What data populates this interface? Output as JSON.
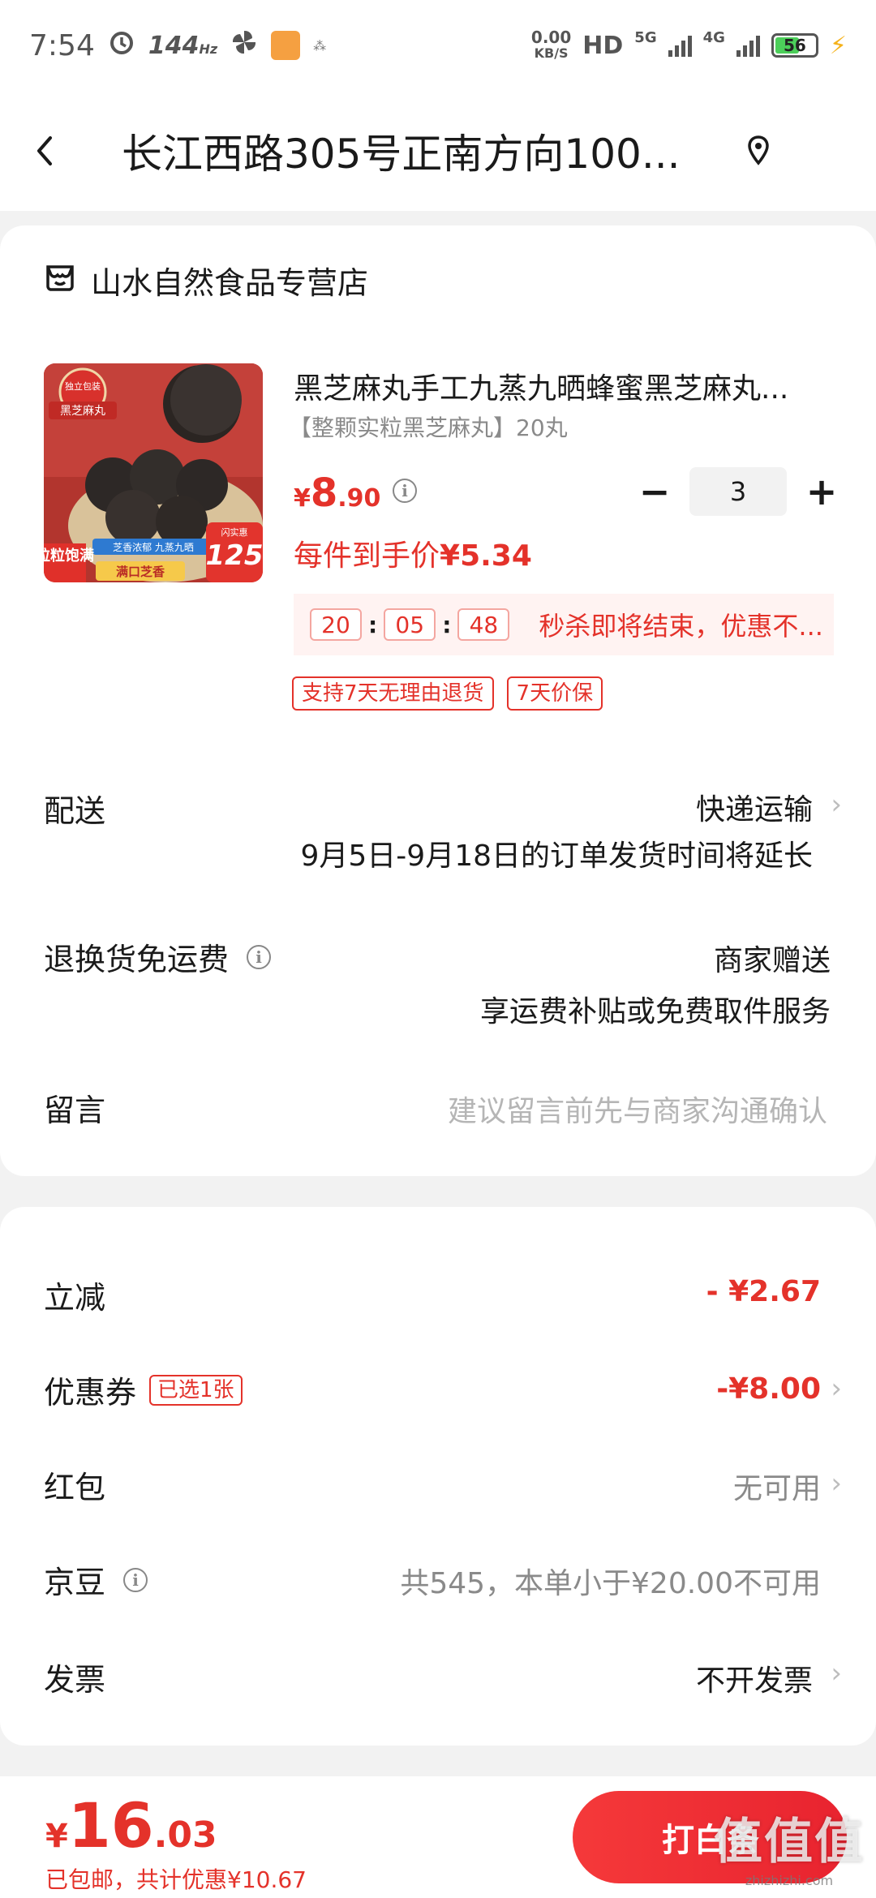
{
  "status_bar": {
    "time": "7:54",
    "refresh_rate": "144",
    "refresh_unit": "Hz",
    "net_speed": "0.00",
    "net_unit": "KB/S",
    "hd": "HD",
    "net_5g": "5G",
    "net_4g": "4G",
    "battery": "56"
  },
  "header": {
    "address": "长江西路305号正南方向100..."
  },
  "store": {
    "name": "山水自然食品专营店"
  },
  "product": {
    "image_text": {
      "badge": "独立包装",
      "name": "黑芝麻丸",
      "banner": "芝香浓郁 九蒸九晒",
      "side": "粒粒饱满",
      "count_label": "闪实惠",
      "count": "125",
      "bottom": "满口芝香"
    },
    "title": "黑芝麻丸手工九蒸九晒蜂蜜黑芝麻丸...",
    "spec": "【整颗实粒黑芝麻丸】20丸",
    "price_symbol": "¥",
    "price_int": "8",
    "price_dec": ".90",
    "quantity": "3",
    "final_price_label": "每件到手价",
    "final_price": "¥5.34",
    "timer": {
      "h": "20",
      "m": "05",
      "s": "48"
    },
    "flash_text": "秒杀即将结束，优惠不...",
    "tags": [
      "支持7天无理由退货",
      "7天价保"
    ]
  },
  "delivery": {
    "label": "配送",
    "method": "快递运输",
    "note": "9月5日-9月18日的订单发货时间将延长"
  },
  "return_shipping": {
    "label": "退换货免运费",
    "value": "商家赠送",
    "note": "享运费补贴或免费取件服务"
  },
  "message": {
    "label": "留言",
    "placeholder": "建议留言前先与商家沟通确认"
  },
  "discounts": {
    "instant": {
      "label": "立减",
      "value": "- ¥2.67"
    },
    "coupon": {
      "label": "优惠券",
      "badge": "已选1张",
      "value": "-¥8.00"
    },
    "red_packet": {
      "label": "红包",
      "value": "无可用"
    },
    "jd_beans": {
      "label": "京豆",
      "value": "共545，本单小于¥20.00不可用"
    },
    "invoice": {
      "label": "发票",
      "value": "不开发票"
    }
  },
  "bottom": {
    "total_symbol": "¥",
    "total_int": "16",
    "total_dec": ".03",
    "note": "已包邮，共计优惠¥10.67",
    "pay_label": "打白条",
    "watermark": "值值值",
    "watermark_sub": "zhizhizhi.com"
  },
  "colors": {
    "accent": "#e4322a",
    "background": "#f2f2f2",
    "card": "#ffffff"
  }
}
